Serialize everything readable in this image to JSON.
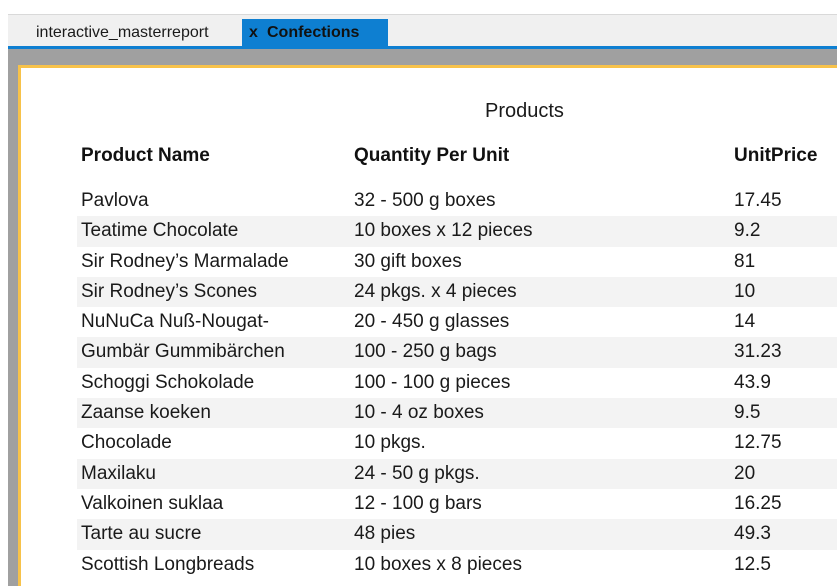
{
  "tabs": [
    {
      "label": "interactive_masterreport",
      "active": false
    },
    {
      "label": "Confections",
      "active": true,
      "close_glyph": "x"
    }
  ],
  "report": {
    "title": "Products",
    "columns": [
      "Product Name",
      "Quantity Per Unit",
      "UnitPrice"
    ],
    "rows": [
      {
        "name": "Pavlova",
        "qty": "32 - 500 g boxes",
        "price": "17.45"
      },
      {
        "name": "Teatime Chocolate",
        "qty": "10 boxes x 12 pieces",
        "price": "9.2"
      },
      {
        "name": "Sir Rodney’s Marmalade",
        "qty": "30 gift boxes",
        "price": "81"
      },
      {
        "name": "Sir Rodney’s Scones",
        "qty": "24 pkgs. x 4 pieces",
        "price": "10"
      },
      {
        "name": "NuNuCa Nuß-Nougat-",
        "qty": "20 - 450 g glasses",
        "price": "14"
      },
      {
        "name": "Gumbär Gummibärchen",
        "qty": "100 - 250 g bags",
        "price": "31.23"
      },
      {
        "name": "Schoggi Schokolade",
        "qty": "100 - 100 g pieces",
        "price": "43.9"
      },
      {
        "name": "Zaanse koeken",
        "qty": "10 - 4 oz boxes",
        "price": "9.5"
      },
      {
        "name": "Chocolade",
        "qty": "10 pkgs.",
        "price": "12.75"
      },
      {
        "name": "Maxilaku",
        "qty": "24 - 50 g pkgs.",
        "price": "20"
      },
      {
        "name": "Valkoinen suklaa",
        "qty": "12 - 100 g bars",
        "price": "16.25"
      },
      {
        "name": "Tarte au sucre",
        "qty": "48 pies",
        "price": "49.3"
      },
      {
        "name": "Scottish Longbreads",
        "qty": "10 boxes x 8 pieces",
        "price": "12.5"
      }
    ]
  },
  "colors": {
    "active_tab": "#0e7fd1",
    "page_border": "#f7c24a",
    "canvas": "#a0a0a0",
    "row_alt": "#f3f3f3"
  }
}
